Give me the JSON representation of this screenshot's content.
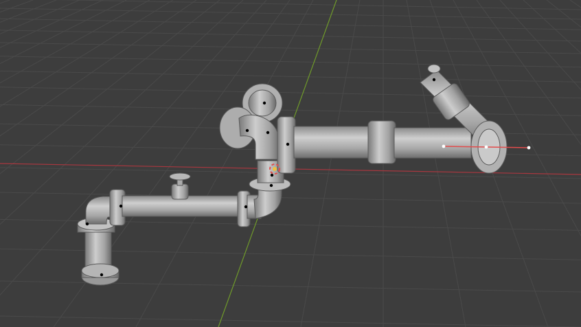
{
  "viewport": {
    "background": "#3d3d3d",
    "grid_color": "#4a4a4a",
    "x_axis_color": "#a8373f",
    "y_axis_color": "#6f9a2a"
  },
  "scene": {
    "pipe_color": "#a9a9a9",
    "pipe_shade": "#7f7f7f",
    "pipe_highlight": "#d4d4d4",
    "vertex_color": "#000000",
    "selected_vertex_color": "#ffffff",
    "selected_edge_color": "#e24c4c",
    "origin_icon": "3d-cursor-icon"
  }
}
